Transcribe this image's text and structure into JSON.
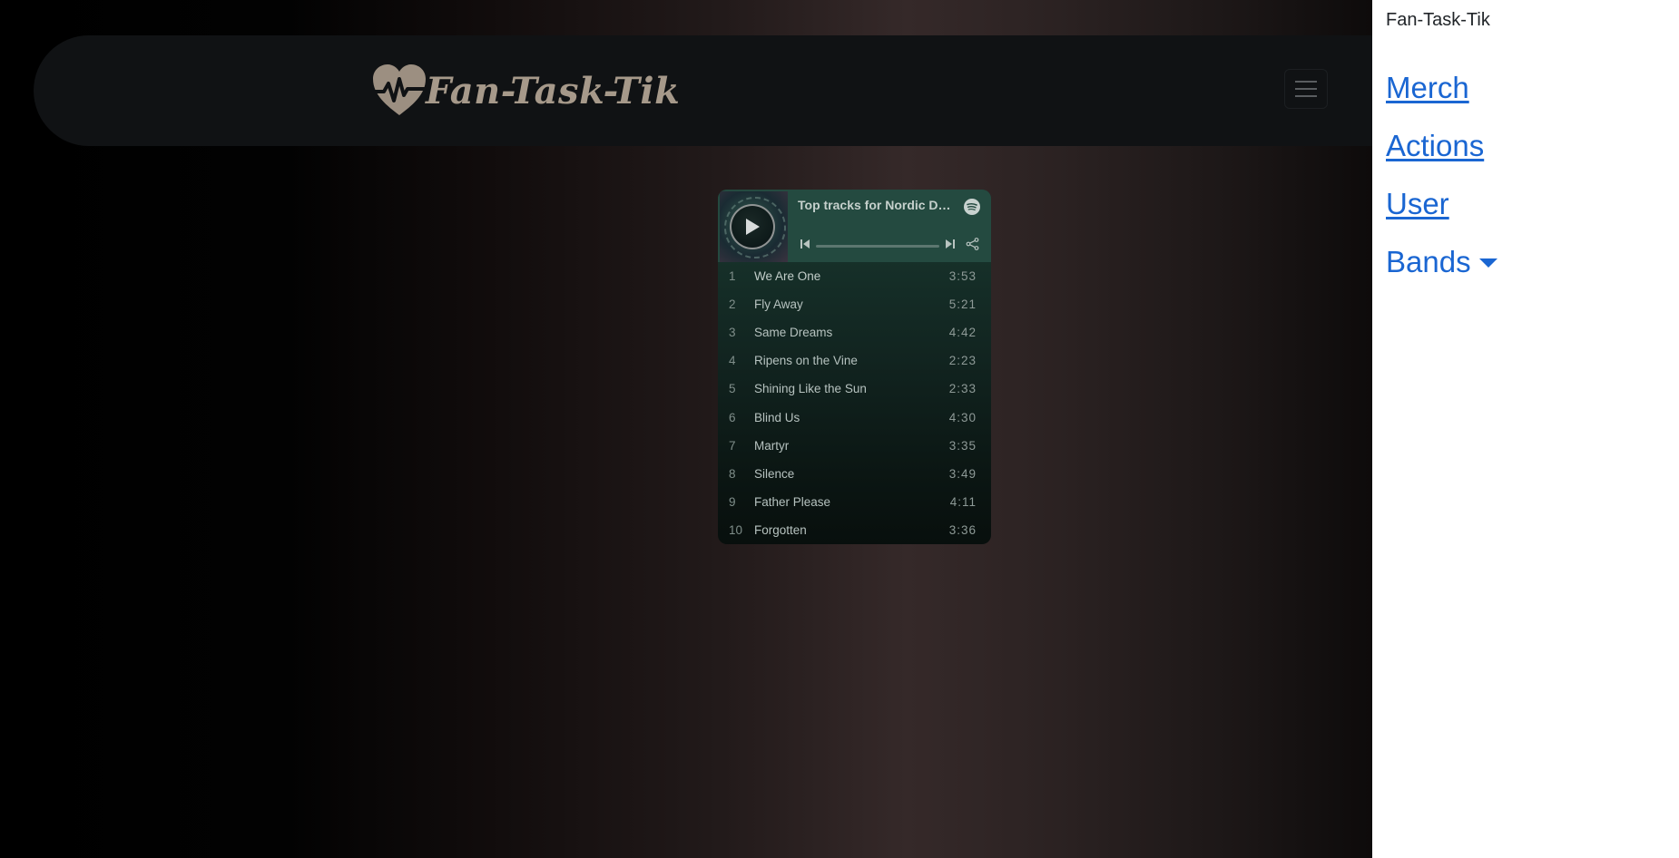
{
  "brand": {
    "name": "Fan-Task-Tik",
    "logo_icon": "heartbeat-heart-icon"
  },
  "navbar": {
    "toggler_icon": "hamburger-menu-icon"
  },
  "player": {
    "title": "Top tracks for Nordic Dusk",
    "service_icon": "spotify-icon",
    "tracks": [
      {
        "num": "1",
        "name": "We Are One",
        "duration": "3:53"
      },
      {
        "num": "2",
        "name": "Fly Away",
        "duration": "5:21"
      },
      {
        "num": "3",
        "name": "Same Dreams",
        "duration": "4:42"
      },
      {
        "num": "4",
        "name": "Ripens on the Vine",
        "duration": "2:23"
      },
      {
        "num": "5",
        "name": "Shining Like the Sun",
        "duration": "2:33"
      },
      {
        "num": "6",
        "name": "Blind Us",
        "duration": "4:30"
      },
      {
        "num": "7",
        "name": "Martyr",
        "duration": "3:35"
      },
      {
        "num": "8",
        "name": "Silence",
        "duration": "3:49"
      },
      {
        "num": "9",
        "name": "Father Please",
        "duration": "4:11"
      },
      {
        "num": "10",
        "name": "Forgotten",
        "duration": "3:36"
      }
    ]
  },
  "offcanvas": {
    "title": "Fan-Task-Tik",
    "links": {
      "merch": "Merch",
      "actions": "Actions",
      "user": "User",
      "bands": "Bands"
    }
  },
  "colors": {
    "link": "#1a66d2",
    "brand_text": "#a6998a",
    "player_green": "#244a40"
  }
}
